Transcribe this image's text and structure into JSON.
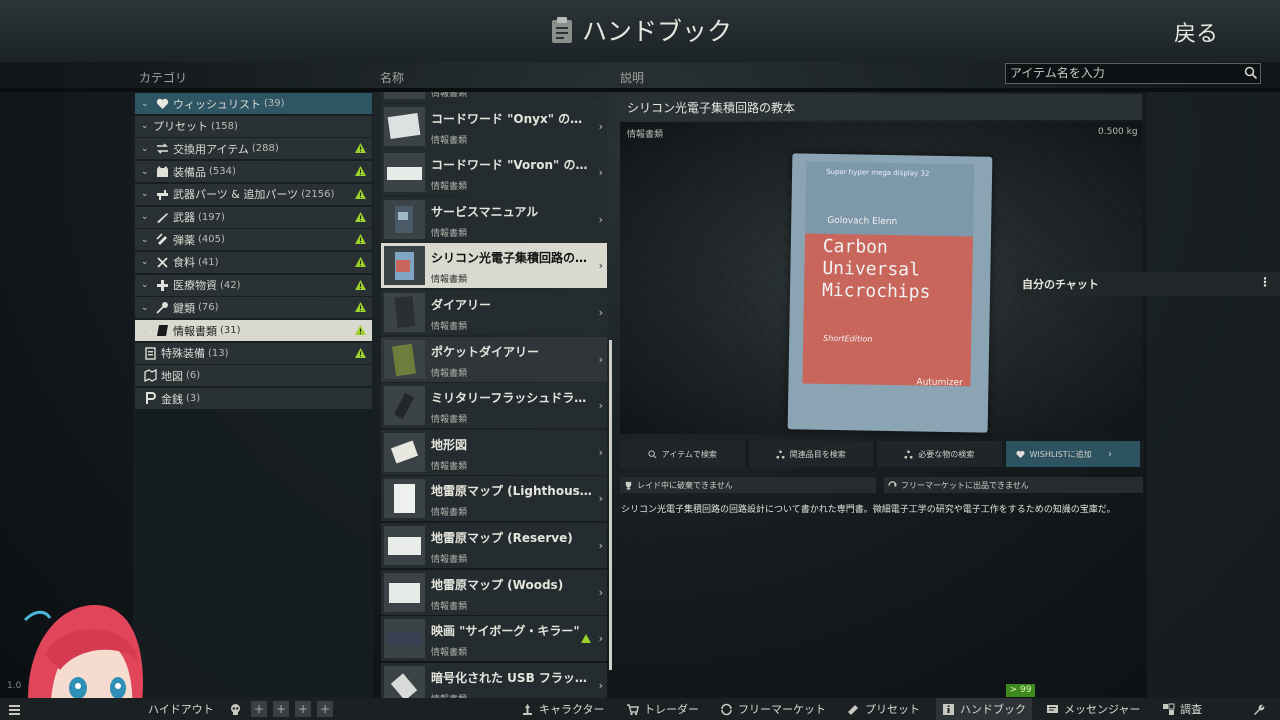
{
  "header": {
    "title": "ハンドブック",
    "back_label": "戻る"
  },
  "columns": {
    "category": "カテゴリ",
    "name": "名称",
    "description": "説明"
  },
  "search": {
    "placeholder": "アイテム名を入力"
  },
  "categories": [
    {
      "label": "ウィッシュリスト",
      "count": "(39)",
      "icon": "heart-icon",
      "warn": false,
      "state": "wish"
    },
    {
      "label": "プリセット",
      "count": "(158)",
      "icon": "",
      "warn": false,
      "state": ""
    },
    {
      "label": "交換用アイテム",
      "count": "(288)",
      "icon": "barter-icon",
      "warn": true,
      "state": ""
    },
    {
      "label": "装備品",
      "count": "(534)",
      "icon": "gear-vest-icon",
      "warn": true,
      "state": ""
    },
    {
      "label": "武器パーツ & 追加パーツ",
      "count": "(2156)",
      "icon": "weapon-parts-icon",
      "warn": true,
      "state": ""
    },
    {
      "label": "武器",
      "count": "(197)",
      "icon": "rifle-icon",
      "warn": true,
      "state": ""
    },
    {
      "label": "弾薬",
      "count": "(405)",
      "icon": "ammo-icon",
      "warn": true,
      "state": ""
    },
    {
      "label": "食料",
      "count": "(41)",
      "icon": "food-icon",
      "warn": true,
      "state": ""
    },
    {
      "label": "医療物資",
      "count": "(42)",
      "icon": "medical-icon",
      "warn": true,
      "state": ""
    },
    {
      "label": "鍵類",
      "count": "(76)",
      "icon": "key-icon",
      "warn": true,
      "state": ""
    },
    {
      "label": "情報書類",
      "count": "(31)",
      "icon": "document-icon",
      "warn": true,
      "state": "sel"
    },
    {
      "label": "特殊装備",
      "count": "(13)",
      "icon": "special-icon",
      "warn": true,
      "state": ""
    },
    {
      "label": "地図",
      "count": "(6)",
      "icon": "map-icon",
      "warn": false,
      "state": ""
    },
    {
      "label": "金銭",
      "count": "(3)",
      "icon": "money-icon",
      "warn": false,
      "state": ""
    }
  ],
  "items": [
    {
      "name": "",
      "sub": "情報書類",
      "state": ""
    },
    {
      "name": "コードワード \"Onyx\" のメモ",
      "sub": "情報書類",
      "state": ""
    },
    {
      "name": "コードワード \"Voron\" のメモ",
      "sub": "情報書類",
      "state": ""
    },
    {
      "name": "サービスマニュアル",
      "sub": "情報書類",
      "state": ""
    },
    {
      "name": "シリコン光電子集積回路の教本",
      "sub": "情報書類",
      "state": "sel"
    },
    {
      "name": "ダイアリー",
      "sub": "情報書類",
      "state": ""
    },
    {
      "name": "ポケットダイアリー",
      "sub": "情報書類",
      "state": "dim"
    },
    {
      "name": "ミリタリーフラッシュドライブ",
      "sub": "情報書類",
      "state": ""
    },
    {
      "name": "地形図",
      "sub": "情報書類",
      "state": ""
    },
    {
      "name": "地雷原マップ (Lighthouse)",
      "sub": "情報書類",
      "state": ""
    },
    {
      "name": "地雷原マップ (Reserve)",
      "sub": "情報書類",
      "state": ""
    },
    {
      "name": "地雷原マップ (Woods)",
      "sub": "情報書類",
      "state": ""
    },
    {
      "name": "映画 \"サイボーグ・キラー\"",
      "sub": "情報書類",
      "state": "warn"
    },
    {
      "name": "暗号化された USB フラッシュドライブ",
      "sub": "情報書類",
      "state": ""
    }
  ],
  "detail": {
    "title": "シリコン光電子集積回路の教本",
    "category": "情報書類",
    "weight": "0.500 kg",
    "book": {
      "series": "Super hyper mega display 32",
      "author": "Golovach Elenn",
      "title_lines": [
        "Carbon",
        "Universal",
        "Microchips"
      ],
      "edition": "ShortEdition",
      "publisher": "Autumizer"
    },
    "actions": [
      "アイテムで検索",
      "関連品目を検索",
      "必要な物の検索",
      "WISHLISTに追加"
    ],
    "flags": [
      "レイド中に破棄できません",
      "フリーマーケットに出品できません"
    ],
    "text": "シリコン光電子集積回路の回路設計について書かれた専門書。微細電子工学の研究や電子工作をするための知識の宝庫だ。"
  },
  "chat": {
    "label": "自分のチャット",
    "menu": "⋮"
  },
  "bottom": {
    "hideout": "ハイドアウト",
    "traders": "キャラクター",
    "trader": "トレーダー",
    "flea": "フリーマーケット",
    "presets": "プリセット",
    "handbook": "ハンドブック",
    "messenger": "メッセンジャー",
    "survey": "調査",
    "badge": "> 99",
    "version": "1.0"
  },
  "colors": {
    "accent": "#2e5563",
    "selected": "#d9d9cf",
    "warn": "#9bd12a",
    "badge": "#3f8a1e"
  }
}
